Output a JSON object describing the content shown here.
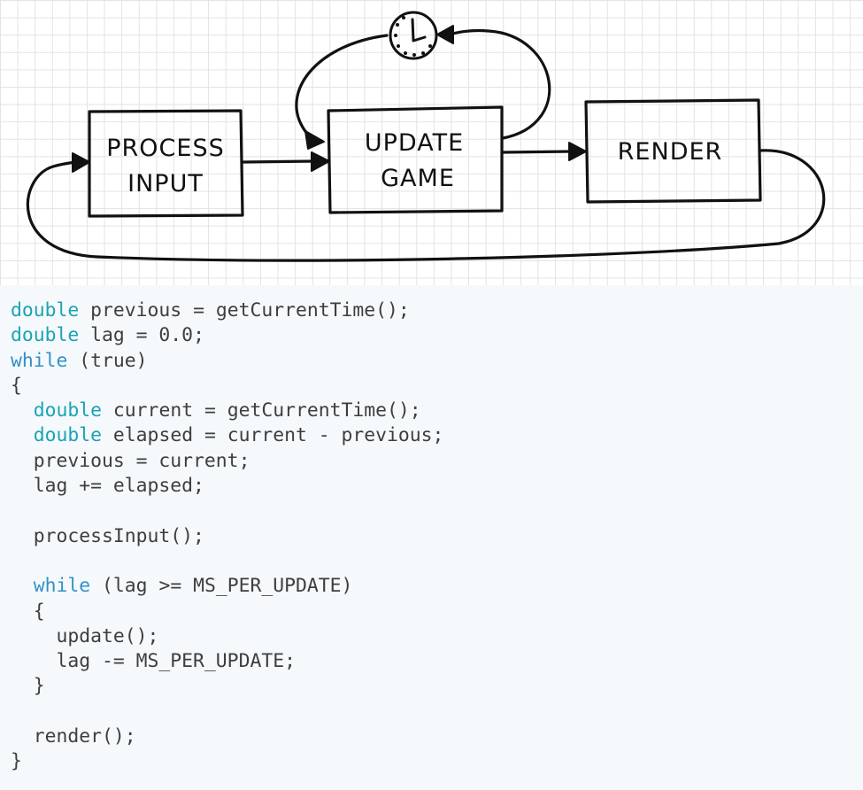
{
  "diagram": {
    "boxes": {
      "process_input": [
        "PROCESS",
        "INPUT"
      ],
      "update_game": [
        "UPDATE",
        "GAME"
      ],
      "render": [
        "RENDER"
      ]
    },
    "icon": "clock-icon"
  },
  "code": {
    "lines": [
      [
        {
          "t": "double",
          "k": "type"
        },
        {
          "t": " previous = getCurrentTime();"
        }
      ],
      [
        {
          "t": "double",
          "k": "type"
        },
        {
          "t": " lag = 0.0;"
        }
      ],
      [
        {
          "t": "while",
          "k": "keyword"
        },
        {
          "t": " (true)"
        }
      ],
      [
        {
          "t": "{"
        }
      ],
      [
        {
          "t": "  "
        },
        {
          "t": "double",
          "k": "type"
        },
        {
          "t": " current = getCurrentTime();"
        }
      ],
      [
        {
          "t": "  "
        },
        {
          "t": "double",
          "k": "type"
        },
        {
          "t": " elapsed = current - previous;"
        }
      ],
      [
        {
          "t": "  previous = current;"
        }
      ],
      [
        {
          "t": "  lag += elapsed;"
        }
      ],
      [
        {
          "t": ""
        }
      ],
      [
        {
          "t": "  processInput();"
        }
      ],
      [
        {
          "t": ""
        }
      ],
      [
        {
          "t": "  "
        },
        {
          "t": "while",
          "k": "keyword"
        },
        {
          "t": " (lag >= MS_PER_UPDATE)"
        }
      ],
      [
        {
          "t": "  {"
        }
      ],
      [
        {
          "t": "    update();"
        }
      ],
      [
        {
          "t": "    lag -= MS_PER_UPDATE;"
        }
      ],
      [
        {
          "t": "  }"
        }
      ],
      [
        {
          "t": ""
        }
      ],
      [
        {
          "t": "  render();"
        }
      ],
      [
        {
          "t": "}"
        }
      ]
    ]
  },
  "colors": {
    "type": "#1ba3b4",
    "keyword": "#3391c6",
    "text": "#3e3e3e",
    "ink": "#111111"
  }
}
